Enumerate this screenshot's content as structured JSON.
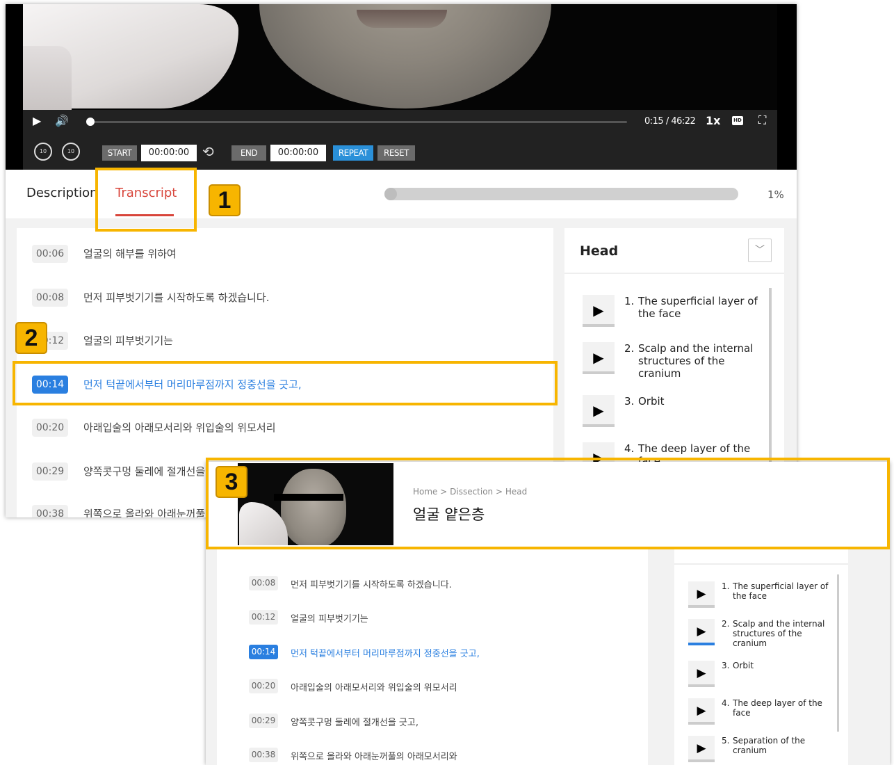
{
  "video": {
    "timecode": "0:15 / 46:22",
    "progress": 0.006,
    "speed": "1x",
    "hd": "HD",
    "skip_back": "10",
    "skip_forward": "10",
    "ab_start_label": "START",
    "ab_start_time": "00:00:00",
    "ab_end_label": "END",
    "ab_end_time": "00:00:00",
    "repeat_label": "REPEAT",
    "reset_label": "RESET"
  },
  "tabs": {
    "description": "Description",
    "transcript": "Transcript"
  },
  "watch_progress": {
    "percent_text": "1%",
    "value": 0.01
  },
  "transcript": [
    {
      "time": "00:06",
      "text": "얼굴의 해부를 위하여"
    },
    {
      "time": "00:08",
      "text": "먼저 피부벗기기를 시작하도록 하겠습니다."
    },
    {
      "time": "00:12",
      "text": "얼굴의 피부벗기기는"
    },
    {
      "time": "00:14",
      "text": "먼저 턱끝에서부터 머리마루점까지 정중선을 긋고,"
    },
    {
      "time": "00:20",
      "text": "아래입술의 아래모서리와 위입술의 위모서리"
    },
    {
      "time": "00:29",
      "text": "양쪽콧구멍 둘레에 절개선을 긋고,"
    },
    {
      "time": "00:38",
      "text": "위쪽으로 올라와 아래눈꺼풀의 아래모서리와"
    }
  ],
  "active_index": 3,
  "chapters": {
    "title": "Head",
    "items": [
      {
        "num": "1.",
        "label": "The superficial layer of the face"
      },
      {
        "num": "2.",
        "label": "Scalp and the internal structures of the cranium"
      },
      {
        "num": "3.",
        "label": "Orbit"
      },
      {
        "num": "4.",
        "label": "The deep layer of the face"
      },
      {
        "num": "5.",
        "label": "Separation of the cranium"
      }
    ]
  },
  "lesson": {
    "breadcrumb": "Home > Dissection > Head",
    "title": "얼굴 얕은층"
  },
  "badges": [
    "1",
    "2",
    "3"
  ],
  "colors": {
    "highlight": "#f7b500",
    "accent": "#2a7fe0",
    "tab_active": "#d8453b"
  }
}
